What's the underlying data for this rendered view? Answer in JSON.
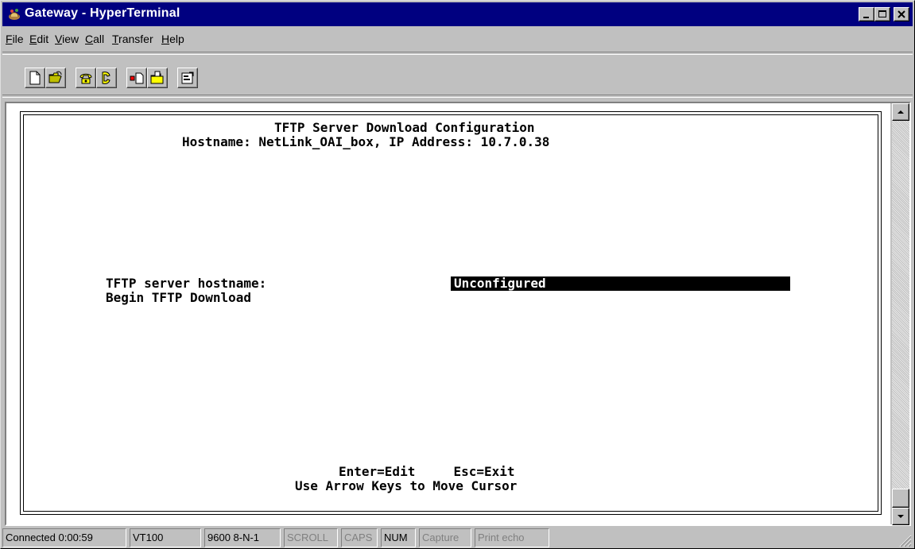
{
  "window": {
    "title": "Gateway - HyperTerminal"
  },
  "menu": [
    {
      "label": "File",
      "accel": "F",
      "rest": "ile"
    },
    {
      "label": "Edit",
      "accel": "E",
      "rest": "dit"
    },
    {
      "label": "View",
      "accel": "V",
      "rest": "iew"
    },
    {
      "label": "Call",
      "accel": "C",
      "rest": "all"
    },
    {
      "label": "Transfer",
      "accel": "T",
      "rest": "ransfer"
    },
    {
      "label": "Help",
      "accel": "H",
      "rest": "elp"
    }
  ],
  "toolbar": [
    "new-icon",
    "open-icon",
    "connect-icon",
    "disconnect-icon",
    "send-icon",
    "receive-icon",
    "properties-icon"
  ],
  "terminal": {
    "heading": "TFTP Server Download Configuration",
    "host_line": "Hostname: NetLink_OAI_box, IP Address: 10.7.0.38",
    "field_label": "TFTP server hostname:",
    "field_value": "Unconfigured",
    "action": "Begin TFTP Download",
    "keys_hint": "Enter=Edit     Esc=Exit",
    "cursor_hint": "Use Arrow Keys to Move Cursor"
  },
  "status": {
    "connected": "Connected 0:00:59",
    "emulation": "VT100",
    "settings": "9600 8-N-1",
    "scroll": "SCROLL",
    "caps": "CAPS",
    "num": "NUM",
    "capture": "Capture",
    "print_echo": "Print echo"
  },
  "colors": {
    "titlebar": "#000080",
    "face": "#c0c0c0",
    "terminal_bg": "#ffffff",
    "highlight": "#000000"
  }
}
